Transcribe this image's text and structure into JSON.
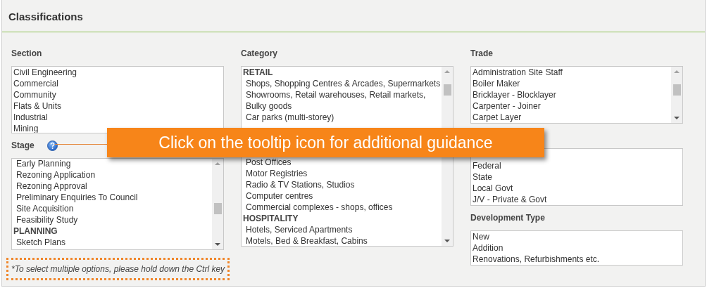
{
  "panel": {
    "title": "Classifications"
  },
  "columns": [
    {
      "fields": [
        {
          "label": "Section",
          "list": {
            "scrollable": false,
            "items": [
              {
                "text": "Civil Engineering",
                "kind": "item"
              },
              {
                "text": "Commercial",
                "kind": "item"
              },
              {
                "text": "Community",
                "kind": "item"
              },
              {
                "text": "Flats & Units",
                "kind": "item"
              },
              {
                "text": "Industrial",
                "kind": "item"
              },
              {
                "text": "Mining",
                "kind": "item"
              }
            ]
          }
        },
        {
          "label": "Stage",
          "help": true,
          "list": {
            "scrollable": true,
            "items": [
              {
                "text": "Early Planning",
                "kind": "option"
              },
              {
                "text": "Rezoning Application",
                "kind": "option"
              },
              {
                "text": "Rezoning Approval",
                "kind": "option"
              },
              {
                "text": "Preliminary Enquiries To Council",
                "kind": "option"
              },
              {
                "text": "Site Acquisition",
                "kind": "option"
              },
              {
                "text": "Feasibility Study",
                "kind": "option"
              },
              {
                "text": "PLANNING",
                "kind": "heading"
              },
              {
                "text": "Sketch Plans",
                "kind": "option"
              }
            ]
          }
        }
      ]
    },
    {
      "fields": [
        {
          "label": "Category",
          "list": {
            "scrollable": true,
            "items": [
              {
                "text": "RETAIL",
                "kind": "heading"
              },
              {
                "text": "Shops, Shopping Centres & Arcades, Supermarkets",
                "kind": "option"
              },
              {
                "text": "Showrooms, Retail warehouses, Retail markets,",
                "kind": "option"
              },
              {
                "text": "Bulky goods",
                "kind": "option"
              },
              {
                "text": "Car parks (multi-storey)",
                "kind": "option"
              },
              {
                "kind": "gap"
              },
              {
                "kind": "gap"
              },
              {
                "kind": "gap"
              },
              {
                "text": "Post Offices",
                "kind": "option"
              },
              {
                "text": "Motor Registries",
                "kind": "option"
              },
              {
                "text": "Radio & TV Stations, Studios",
                "kind": "option"
              },
              {
                "text": "Computer centres",
                "kind": "option"
              },
              {
                "text": "Commercial complexes - shops, offices",
                "kind": "option"
              },
              {
                "text": "HOSPITALITY",
                "kind": "heading"
              },
              {
                "text": "Hotels, Serviced Apartments",
                "kind": "option"
              },
              {
                "text": "Motels, Bed & Breakfast, Cabins",
                "kind": "option"
              }
            ]
          }
        }
      ]
    },
    {
      "fields": [
        {
          "label": "Trade",
          "list": {
            "scrollable": true,
            "items": [
              {
                "text": "Administration Site Staff",
                "kind": "item"
              },
              {
                "text": "Boiler Maker",
                "kind": "item"
              },
              {
                "text": "Bricklayer - Blocklayer",
                "kind": "item"
              },
              {
                "text": "Carpenter - Joiner",
                "kind": "item"
              },
              {
                "text": "Carpet Layer",
                "kind": "item"
              }
            ]
          }
        },
        {
          "list": {
            "scrollable": false,
            "items": [
              {
                "kind": "gap"
              },
              {
                "text": "Federal",
                "kind": "item"
              },
              {
                "text": "State",
                "kind": "item"
              },
              {
                "text": "Local Govt",
                "kind": "item"
              },
              {
                "text": "J/V - Private & Govt",
                "kind": "item"
              }
            ]
          }
        },
        {
          "label": "Development Type",
          "list": {
            "scrollable": false,
            "items": [
              {
                "text": "New",
                "kind": "item"
              },
              {
                "text": "Addition",
                "kind": "item"
              },
              {
                "text": "Renovations, Refurbishments etc.",
                "kind": "item"
              }
            ]
          }
        }
      ]
    }
  ],
  "note": "*To select multiple options, please hold down the Ctrl key",
  "callout": "Click on the tooltip icon for additional guidance"
}
